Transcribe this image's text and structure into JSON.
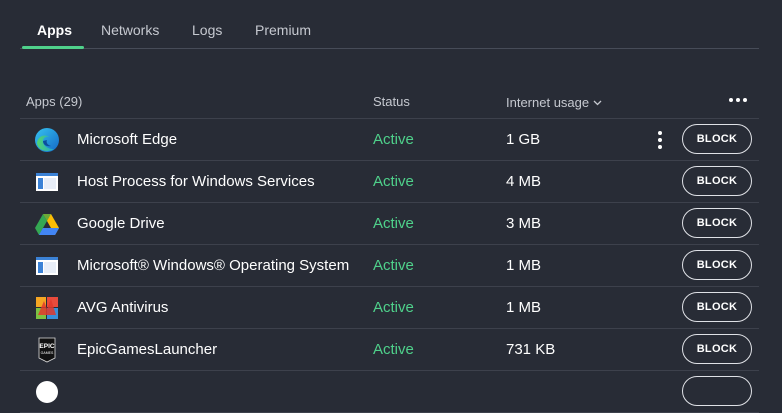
{
  "tabs": [
    {
      "label": "Apps",
      "active": true
    },
    {
      "label": "Networks",
      "active": false
    },
    {
      "label": "Logs",
      "active": false
    },
    {
      "label": "Premium",
      "active": false
    }
  ],
  "table": {
    "headers": {
      "apps": "Apps (29)",
      "status": "Status",
      "usage": "Internet usage"
    },
    "rows": [
      {
        "name": "Microsoft Edge",
        "status": "Active",
        "usage": "1 GB",
        "icon": "edge-icon",
        "action": "BLOCK"
      },
      {
        "name": "Host Process for Windows Services",
        "status": "Active",
        "usage": "4 MB",
        "icon": "window-app-icon",
        "action": "BLOCK"
      },
      {
        "name": "Google Drive",
        "status": "Active",
        "usage": "3 MB",
        "icon": "google-drive-icon",
        "action": "BLOCK"
      },
      {
        "name": "Microsoft® Windows® Operating System",
        "status": "Active",
        "usage": "1 MB",
        "icon": "window-app-icon",
        "action": "BLOCK"
      },
      {
        "name": "AVG Antivirus",
        "status": "Active",
        "usage": "1 MB",
        "icon": "avg-icon",
        "action": "BLOCK"
      },
      {
        "name": "EpicGamesLauncher",
        "status": "Active",
        "usage": "731 KB",
        "icon": "epic-games-icon",
        "action": "BLOCK",
        "icon_text_top": "EPIC",
        "icon_text_bottom": "GAMES"
      },
      {
        "name": "",
        "status": "",
        "usage": "",
        "icon": "generic-app-icon",
        "action": ""
      }
    ]
  },
  "colors": {
    "background": "#282c36",
    "accent": "#4fd18b",
    "divider": "#3d414c"
  }
}
